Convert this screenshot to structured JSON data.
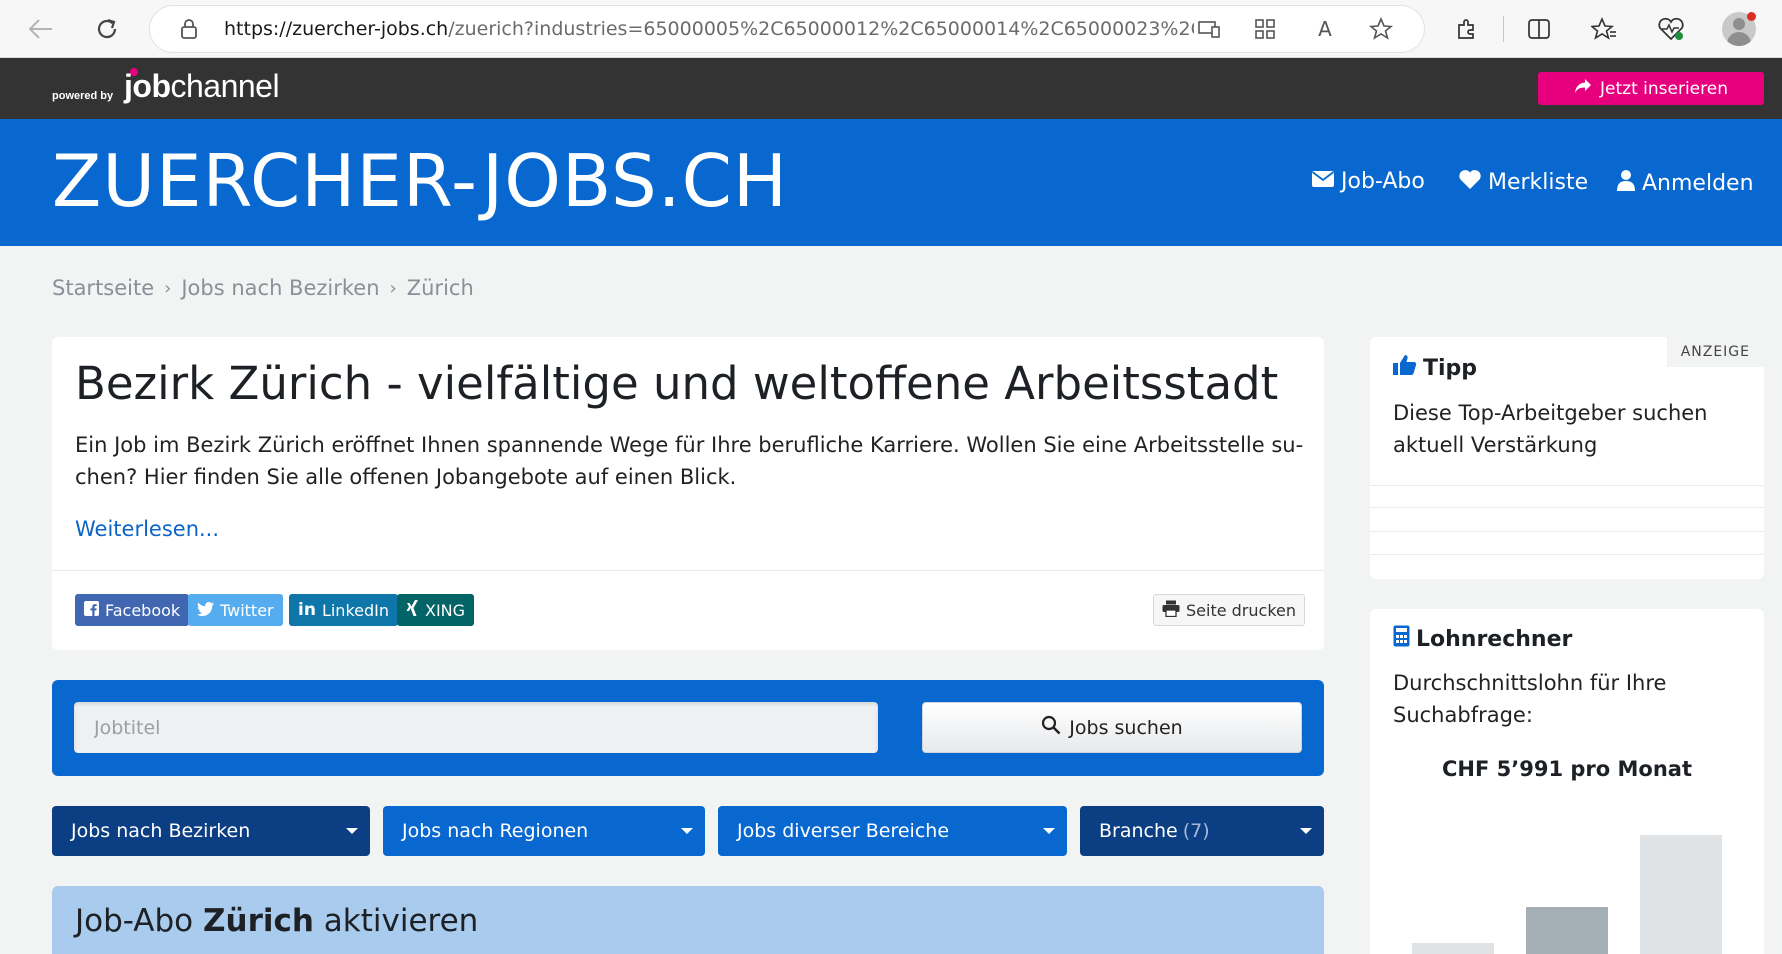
{
  "browser": {
    "url_host": "https://zuercher-jobs.ch",
    "url_path": "/zuerich?industries=65000005%2C65000012%2C65000014%2C65000023%2C..."
  },
  "topbar": {
    "powered_by": "powered by",
    "logo_bold": "job",
    "logo_rest": "channel",
    "insert_button": "Jetzt inserieren"
  },
  "header": {
    "site_title": "ZUERCHER-JOBS.CH",
    "nav": {
      "job_abo": "Job-Abo",
      "merkliste": "Merkliste",
      "anmelden": "Anmelden"
    }
  },
  "breadcrumb": [
    "Startseite",
    "Jobs nach Bezirken",
    "Zürich"
  ],
  "intro": {
    "title": "Bezirk Zürich - vielfältige und weltoffene Arbeitsstadt",
    "text": "Ein Job im Bezirk Zürich eröffnet Ihnen spannende Wege für Ihre berufliche Karriere. Wollen Sie eine Arbeitsstelle su­chen? Hier finden Sie alle offenen Jobangebote auf einen Blick.",
    "read_more": "Weiterlesen...",
    "share": {
      "facebook": "Facebook",
      "twitter": "Twitter",
      "linkedin": "LinkedIn",
      "xing": "XING"
    },
    "print": "Seite drucken"
  },
  "search": {
    "placeholder": "Jobtitel",
    "value": "",
    "button": "Jobs suchen"
  },
  "filters": {
    "bezirke": "Jobs nach Bezirken",
    "regionen": "Jobs nach Regionen",
    "bereiche": "Jobs diverser Bereiche",
    "branche": "Branche",
    "branche_count": "(7)"
  },
  "job_abo": {
    "prefix": "Job-Abo",
    "place": "Zürich",
    "suffix": "aktivieren"
  },
  "sidebar": {
    "tipp": {
      "badge": "ANZEIGE",
      "title": "Tipp",
      "text": "Diese Top-Arbeitgeber suchen aktuell Verstärkung"
    },
    "lohnrechner": {
      "title": "Lohnrechner",
      "text": "Durchschnittslohn für Ihre Suchabfrage:",
      "salary": "CHF 5’991 pro Monat"
    }
  },
  "colors": {
    "brand_blue": "#0868d0",
    "dark_blue": "#0b3e82",
    "magenta": "#e6007e",
    "facebook": "#4267b2",
    "twitter": "#55acee",
    "linkedin": "#0e76a8",
    "xing": "#026466"
  },
  "icons": [
    "back-icon",
    "refresh-icon",
    "lock-icon",
    "star-icon",
    "envelope-icon",
    "heart-icon",
    "user-icon",
    "share-icon",
    "thumbs-up-icon",
    "calculator-icon",
    "search-icon",
    "print-icon"
  ]
}
